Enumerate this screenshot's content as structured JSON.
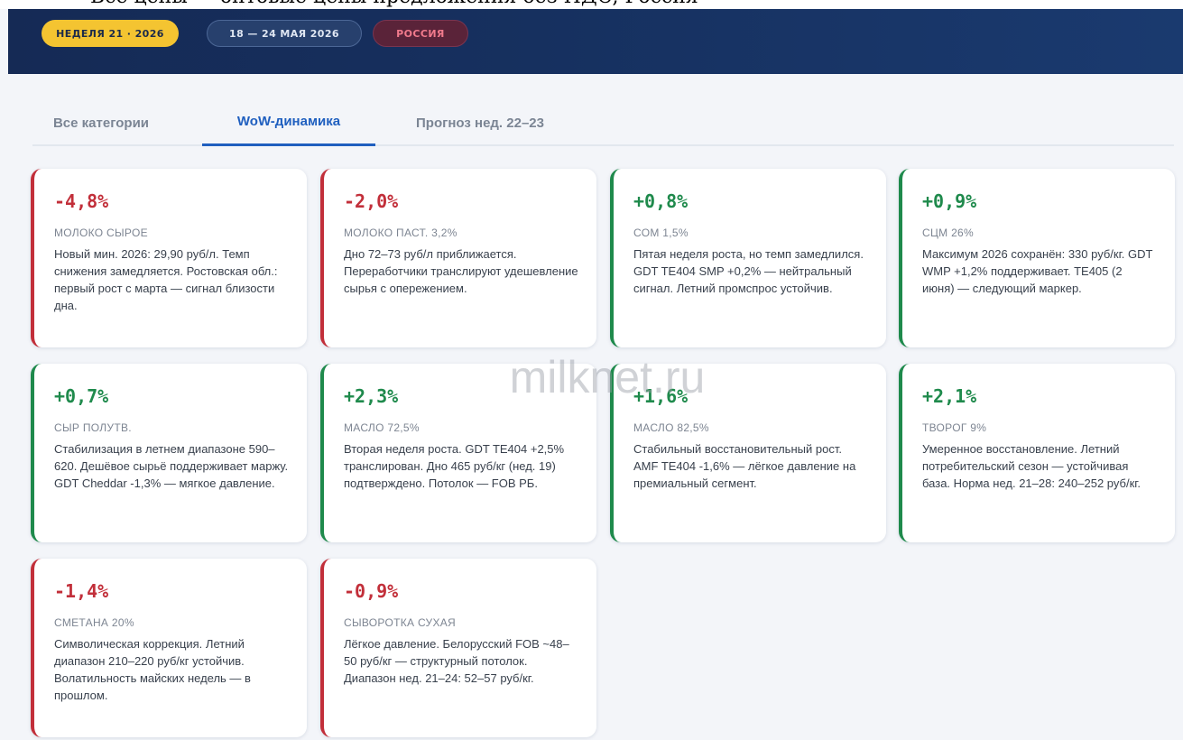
{
  "caption": "Все цены — оптовые цены предложения без НДС, Россия",
  "header": {
    "week_pill": "НЕДЕЛЯ 21 · 2026",
    "dates_pill": "18 — 24 МАЯ 2026",
    "region_pill": "РОССИЯ"
  },
  "tabs": [
    {
      "label": "Все категории"
    },
    {
      "label": "WoW-динамика"
    },
    {
      "label": "Прогноз нед. 22–23"
    }
  ],
  "colors": {
    "negative": "#c22f3a",
    "positive": "#1f8a4c",
    "accent": "#1f5fbf"
  },
  "cards": [
    {
      "change": "-4,8%",
      "name": "МОЛОКО СЫРОЕ",
      "text": "Новый мин. 2026: 29,90 руб/л. Темп снижения замедляется. Ростовская обл.: первый рост с марта — сигнал близости дна."
    },
    {
      "change": "-2,0%",
      "name": "МОЛОКО ПАСТ. 3,2%",
      "text": "Дно 72–73 руб/л приближается. Переработчики транслируют удешевление сырья с опережением."
    },
    {
      "change": "+0,8%",
      "name": "СОМ 1,5%",
      "text": "Пятая неделя роста, но темп замедлился. GDT TE404 SMP +0,2% — нейтральный сигнал. Летний промспрос устойчив."
    },
    {
      "change": "+0,9%",
      "name": "СЦМ 26%",
      "text": "Максимум 2026 сохранён: 330 руб/кг. GDT WMP +1,2% поддерживает. TE405 (2 июня) — следующий маркер."
    },
    {
      "change": "+0,7%",
      "name": "СЫР ПОЛУТВ.",
      "text": "Стабилизация в летнем диапазоне 590–620. Дешёвое сырьё поддерживает маржу. GDT Cheddar -1,3% — мягкое давление."
    },
    {
      "change": "+2,3%",
      "name": "МАСЛО 72,5%",
      "text": "Вторая неделя роста. GDT TE404 +2,5% транслирован. Дно 465 руб/кг (нед. 19) подтверждено. Потолок — FOB РБ."
    },
    {
      "change": "+1,6%",
      "name": "МАСЛО 82,5%",
      "text": "Стабильный восстановительный рост. AMF TE404 -1,6% — лёгкое давление на премиальный сегмент."
    },
    {
      "change": "+2,1%",
      "name": "ТВОРОГ 9%",
      "text": "Умеренное восстановление. Летний потребительский сезон — устойчивая база. Норма нед. 21–28: 240–252 руб/кг."
    },
    {
      "change": "-1,4%",
      "name": "СМЕТАНА 20%",
      "text": "Символическая коррекция. Летний диапазон 210–220 руб/кг устойчив. Волатильность майских недель — в прошлом."
    },
    {
      "change": "-0,9%",
      "name": "СЫВОРОТКА СУХАЯ",
      "text": "Лёгкое давление. Белорусский FOB ~48–50 руб/кг — структурный потолок. Диапазон нед. 21–24: 52–57 руб/кг."
    }
  ],
  "watermark": "milknet.ru"
}
